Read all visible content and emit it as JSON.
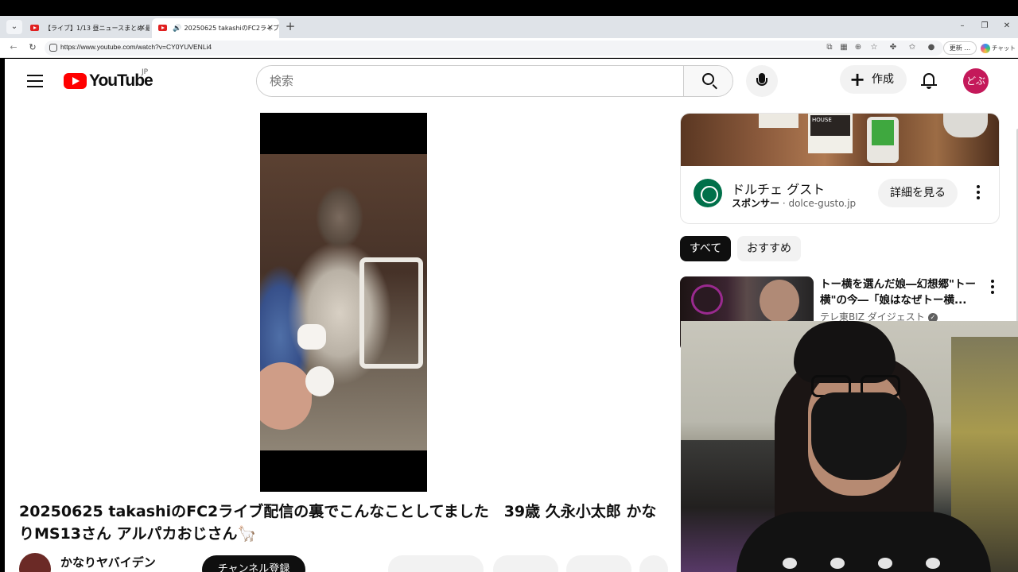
{
  "browser": {
    "tab_dropdown_icon": "chevron-down-icon",
    "tabs": [
      {
        "title": "【ライブ】1/13 昼ニュースまとめ 最新情報",
        "active": false
      },
      {
        "title": "20250625 takashiのFC2ライブ配",
        "active": true,
        "audio": true
      }
    ],
    "url": "https://www.youtube.com/watch?v=CY0YUVENLi4",
    "update_label": "更新 …",
    "copilot_label": "チャット"
  },
  "youtube": {
    "logo_text": "YouTube",
    "logo_region": "JP",
    "search_placeholder": "検索",
    "create_label": "作成",
    "avatar_text": "どぶ"
  },
  "video": {
    "title": "20250625 takashiのFC2ライブ配信の裏でこんなことしてました　39歳 久永小太郎 かなりMS13さん アルパカおじさん🦙",
    "channel_name": "かなりヤバイデン",
    "subscribe_label": "チャンネル登録"
  },
  "ad": {
    "advertiser": "ドルチェ グスト",
    "sponsor_label": "スポンサー",
    "domain": "dolce-gusto.jp",
    "cta_label": "詳細を見る",
    "banner_product_text": "HOUSE"
  },
  "chips": [
    {
      "label": "すべて",
      "selected": true
    },
    {
      "label": "おすすめ",
      "selected": false
    }
  ],
  "recommendations": [
    {
      "title": "トー横を選んだ娘―幻想郷\"トー横\"の今―「娘はなぜトー横...",
      "channel": "テレ東BIZ ダイジェスト",
      "verified": true
    }
  ],
  "colors": {
    "youtube_red": "#ff0000",
    "avatar_bg": "#c4195a",
    "starbucks_green": "#00704a"
  }
}
